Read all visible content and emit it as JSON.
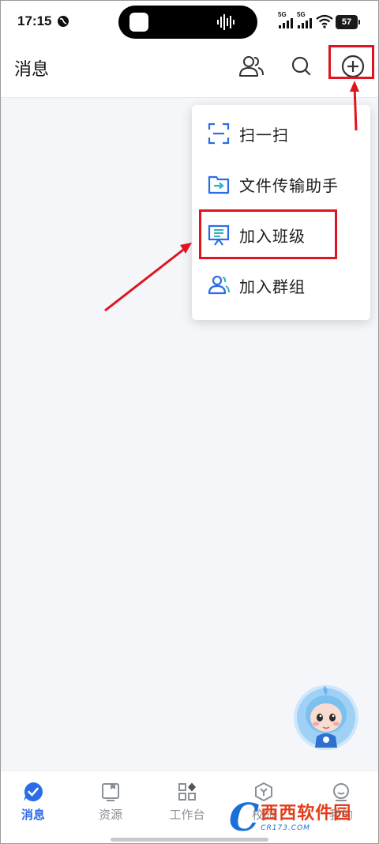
{
  "status_bar": {
    "time": "17:15",
    "signal1": "5G",
    "signal2": "5G",
    "battery": "57"
  },
  "header": {
    "title": "消息",
    "icons": [
      "contacts-icon",
      "search-icon",
      "add-circle-icon"
    ]
  },
  "menu": {
    "items": [
      {
        "label": "扫一扫",
        "icon": "scan-icon"
      },
      {
        "label": "文件传输助手",
        "icon": "file-transfer-icon"
      },
      {
        "label": "加入班级",
        "icon": "presentation-board-icon"
      },
      {
        "label": "加入群组",
        "icon": "group-icon"
      }
    ]
  },
  "bottom_nav": {
    "items": [
      {
        "label": "消息",
        "icon": "message-check-icon",
        "active": true
      },
      {
        "label": "资源",
        "icon": "resource-book-icon",
        "active": false
      },
      {
        "label": "工作台",
        "icon": "workbench-grid-icon",
        "active": false
      },
      {
        "label": "校园",
        "icon": "campus-hexagon-icon",
        "active": false
      },
      {
        "label": "我的",
        "icon": "profile-face-icon",
        "active": false
      }
    ]
  },
  "watermark": {
    "brand": "西西软件园",
    "url": "CR173.COM"
  },
  "colors": {
    "accent": "#2b6de8",
    "annotation": "#e0141e",
    "background": "#f4f6fa"
  }
}
